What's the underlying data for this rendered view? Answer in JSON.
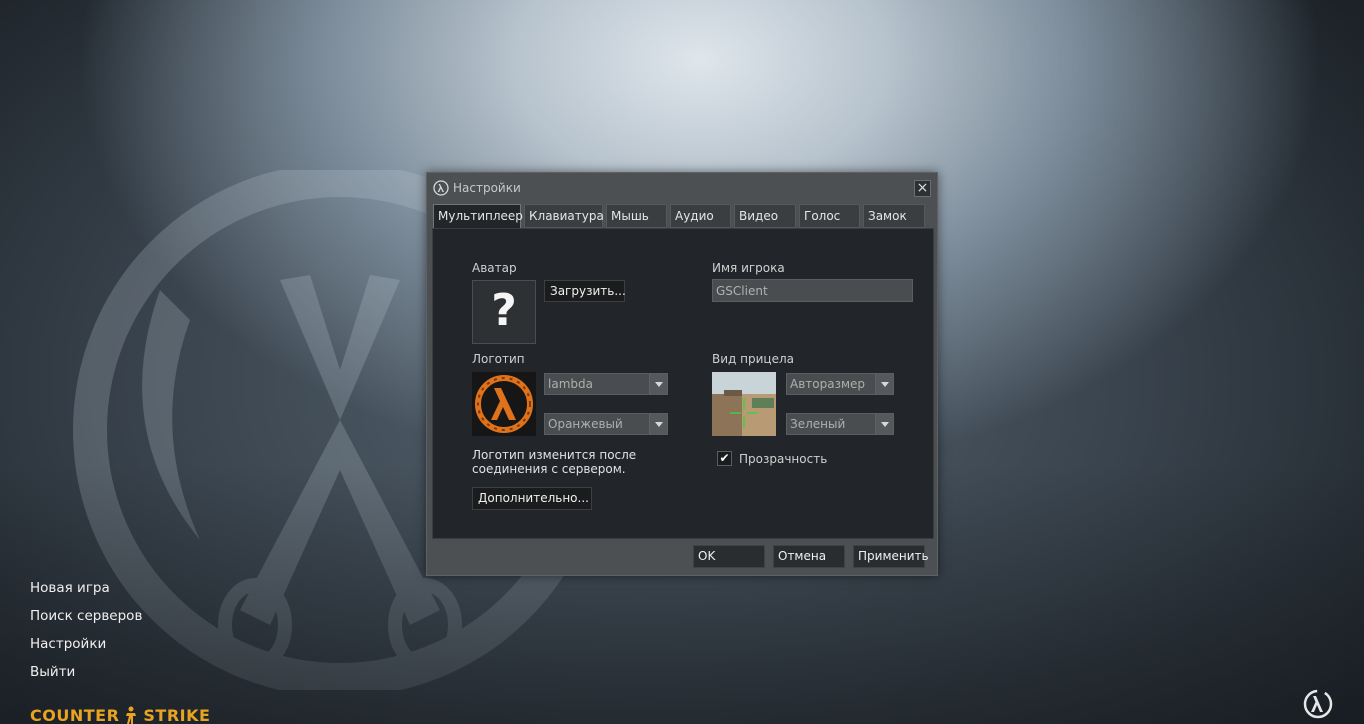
{
  "main_menu": {
    "items": [
      "Новая игра",
      "Поиск серверов",
      "Настройки",
      "Выйти"
    ]
  },
  "game_logo": {
    "left": "COUNTER",
    "right": "STRIKE"
  },
  "dialog": {
    "title": "Настройки",
    "close_symbol": "×",
    "tabs": [
      "Мультиплеер",
      "Клавиатура",
      "Мышь",
      "Аудио",
      "Видео",
      "Голос",
      "Замок"
    ],
    "active_tab": "Мультиплеер",
    "avatar": {
      "label": "Аватар",
      "placeholder_symbol": "?",
      "upload_button": "Загрузить..."
    },
    "player_name": {
      "label": "Имя игрока",
      "value": "GSClient"
    },
    "logo": {
      "label": "Логотип",
      "type_value": "lambda",
      "color_value": "Оранжевый",
      "note": "Логотип изменится после соединения с сервером.",
      "advanced_button": "Дополнительно..."
    },
    "crosshair": {
      "label": "Вид прицела",
      "size_value": "Авторазмер",
      "color_value": "Зеленый",
      "transparency_label": "Прозрачность",
      "transparency_checked": true
    },
    "buttons": {
      "ok": "OK",
      "cancel": "Отмена",
      "apply": "Применить"
    }
  },
  "colors": {
    "accent_logo": "#e8a420",
    "lambda_orange": "#e0721c",
    "crosshair_green": "#3dd23d"
  }
}
